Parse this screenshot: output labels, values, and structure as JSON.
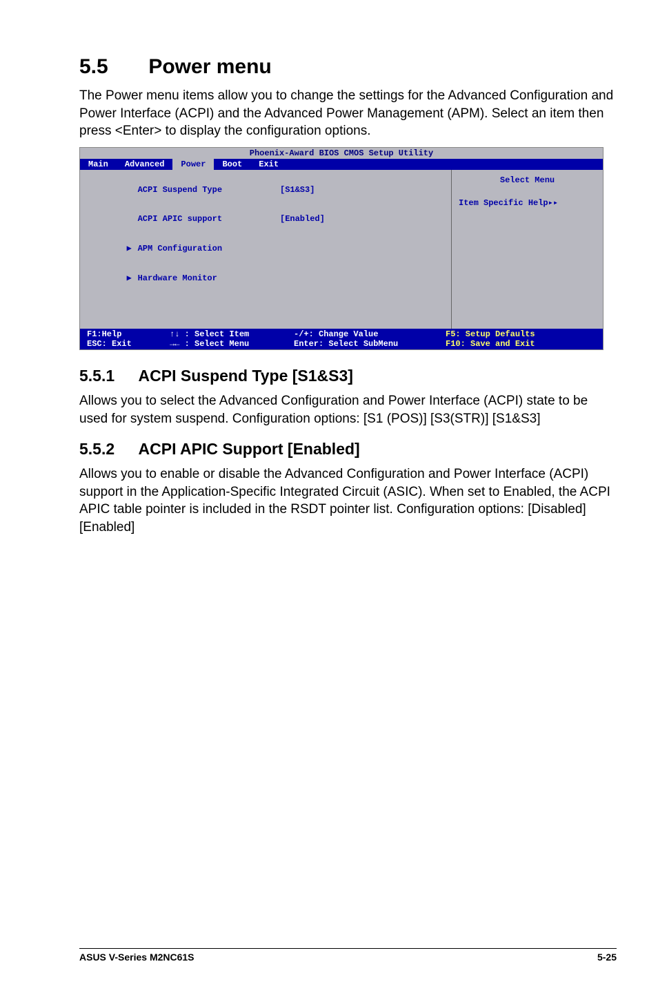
{
  "section": {
    "number": "5.5",
    "title": "Power menu",
    "intro": "The Power menu items allow you to change the settings for the Advanced Configuration and Power Interface (ACPI) and the Advanced Power Management (APM). Select an item then press <Enter> to display the configuration options."
  },
  "bios": {
    "title": "Phoenix-Award BIOS CMOS Setup Utility",
    "tabs": [
      "Main",
      "Advanced",
      "Power",
      "Boot",
      "Exit"
    ],
    "active_tab": "Power",
    "items": [
      {
        "pointer": " ",
        "label": "ACPI Suspend Type",
        "value": "[S1&S3]"
      },
      {
        "pointer": " ",
        "label": "ACPI APIC support",
        "value": "[Enabled]"
      },
      {
        "pointer": "▶",
        "label": "APM Configuration",
        "value": ""
      },
      {
        "pointer": "▶",
        "label": "Hardware Monitor",
        "value": ""
      }
    ],
    "right": {
      "select_menu": "Select Menu",
      "help_label": "Item Specific Help▸▸"
    },
    "footer": {
      "c1a": "F1:Help",
      "c1b": "ESC: Exit",
      "c2a": "↑↓ : Select Item",
      "c2b": "→← : Select Menu",
      "c3a": "-/+: Change Value",
      "c3b": "Enter: Select SubMenu",
      "c4a": "F5: Setup Defaults",
      "c4b": "F10: Save and Exit"
    }
  },
  "sub1": {
    "number": "5.5.1",
    "title": "ACPI Suspend Type [S1&S3]",
    "body": "Allows you to select the Advanced Configuration and Power Interface (ACPI) state to be used for system suspend. Configuration options: [S1 (POS)] [S3(STR)] [S1&S3]"
  },
  "sub2": {
    "number": "5.5.2",
    "title": "ACPI APIC Support [Enabled]",
    "body": "Allows you to enable or disable the Advanced Configuration and Power Interface (ACPI) support in the Application-Specific Integrated Circuit (ASIC). When set to Enabled, the ACPI APIC table pointer is included in the RSDT pointer list. Configuration options: [Disabled] [Enabled]"
  },
  "footer": {
    "left": "ASUS V-Series M2NC61S",
    "right": "5-25"
  }
}
